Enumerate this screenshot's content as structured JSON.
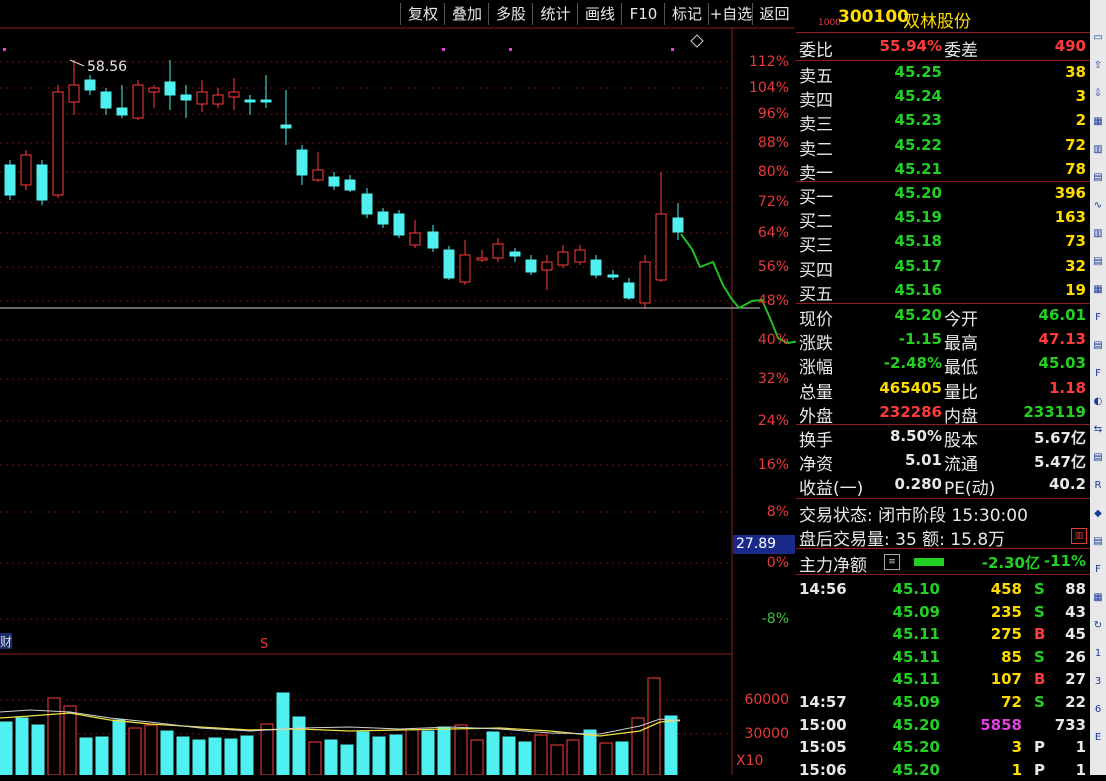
{
  "toolbar": [
    "复权",
    "叠加",
    "多股",
    "统计",
    "画线",
    "F10",
    "标记",
    "+自选",
    "返回"
  ],
  "chart": {
    "high_label": "58.56",
    "pct_scale": [
      "112%",
      "104%",
      "96%",
      "88%",
      "80%",
      "72%",
      "64%",
      "56%",
      "48%",
      "40%",
      "32%",
      "24%",
      "16%",
      "8%",
      "0%",
      "-8%"
    ],
    "current_price_box": "27.89",
    "cai_label": "财",
    "s_marker": "S",
    "vol_scale": [
      "60000",
      "30000"
    ],
    "vol_unit": "X10"
  },
  "stock": {
    "marker": "1000",
    "code": "300100",
    "name": "双林股份"
  },
  "weibi": {
    "label": "委比",
    "value": "55.94%",
    "label2": "委差",
    "value2": "490"
  },
  "asks": [
    {
      "label": "卖五",
      "price": "45.25",
      "vol": "38"
    },
    {
      "label": "卖四",
      "price": "45.24",
      "vol": "3"
    },
    {
      "label": "卖三",
      "price": "45.23",
      "vol": "2"
    },
    {
      "label": "卖二",
      "price": "45.22",
      "vol": "72"
    },
    {
      "label": "卖一",
      "price": "45.21",
      "vol": "78"
    }
  ],
  "bids": [
    {
      "label": "买一",
      "price": "45.20",
      "vol": "396"
    },
    {
      "label": "买二",
      "price": "45.19",
      "vol": "163"
    },
    {
      "label": "买三",
      "price": "45.18",
      "vol": "73"
    },
    {
      "label": "买四",
      "price": "45.17",
      "vol": "32"
    },
    {
      "label": "买五",
      "price": "45.16",
      "vol": "19"
    }
  ],
  "quote": [
    {
      "l1": "现价",
      "v1": "45.20",
      "c1": "green",
      "l2": "今开",
      "v2": "46.01",
      "c2": "green"
    },
    {
      "l1": "涨跌",
      "v1": "-1.15",
      "c1": "green",
      "l2": "最高",
      "v2": "47.13",
      "c2": "red"
    },
    {
      "l1": "涨幅",
      "v1": "-2.48%",
      "c1": "green",
      "l2": "最低",
      "v2": "45.03",
      "c2": "green"
    },
    {
      "l1": "总量",
      "v1": "465405",
      "c1": "yellow",
      "l2": "量比",
      "v2": "1.18",
      "c2": "red"
    },
    {
      "l1": "外盘",
      "v1": "232286",
      "c1": "red",
      "l2": "内盘",
      "v2": "233119",
      "c2": "green"
    }
  ],
  "fund": [
    {
      "l1": "换手",
      "v1": "8.50%",
      "l2": "股本",
      "v2": "5.67亿"
    },
    {
      "l1": "净资",
      "v1": "5.01",
      "l2": "流通",
      "v2": "5.47亿"
    },
    {
      "l1": "收益(一)",
      "v1": "0.280",
      "l2": "PE(动)",
      "v2": "40.2"
    }
  ],
  "status": {
    "line1": "交易状态: 闭市阶段 15:30:00",
    "line2": "盘后交易量: 35  额: 15.8万"
  },
  "mainforce": {
    "label": "主力净额",
    "value": "-2.30亿",
    "pct": "-11%"
  },
  "ticks": [
    {
      "time": "14:56",
      "price": "45.10",
      "vol": "458",
      "bs": "S",
      "n": "88",
      "vc": "yellow"
    },
    {
      "time": "",
      "price": "45.09",
      "vol": "235",
      "bs": "S",
      "n": "43",
      "vc": "yellow"
    },
    {
      "time": "",
      "price": "45.11",
      "vol": "275",
      "bs": "B",
      "n": "45",
      "vc": "yellow"
    },
    {
      "time": "",
      "price": "45.11",
      "vol": "85",
      "bs": "S",
      "n": "26",
      "vc": "yellow"
    },
    {
      "time": "",
      "price": "45.11",
      "vol": "107",
      "bs": "B",
      "n": "27",
      "vc": "yellow"
    },
    {
      "time": "14:57",
      "price": "45.09",
      "vol": "72",
      "bs": "S",
      "n": "22",
      "vc": "yellow"
    },
    {
      "time": "15:00",
      "price": "45.20",
      "vol": "5858",
      "bs": "",
      "n": "733",
      "vc": "magenta"
    },
    {
      "time": "15:05",
      "price": "45.20",
      "vol": "3",
      "bs": "P",
      "n": "1",
      "vc": "yellow"
    },
    {
      "time": "15:06",
      "price": "45.20",
      "vol": "1",
      "bs": "P",
      "n": "1",
      "vc": "yellow"
    }
  ]
}
